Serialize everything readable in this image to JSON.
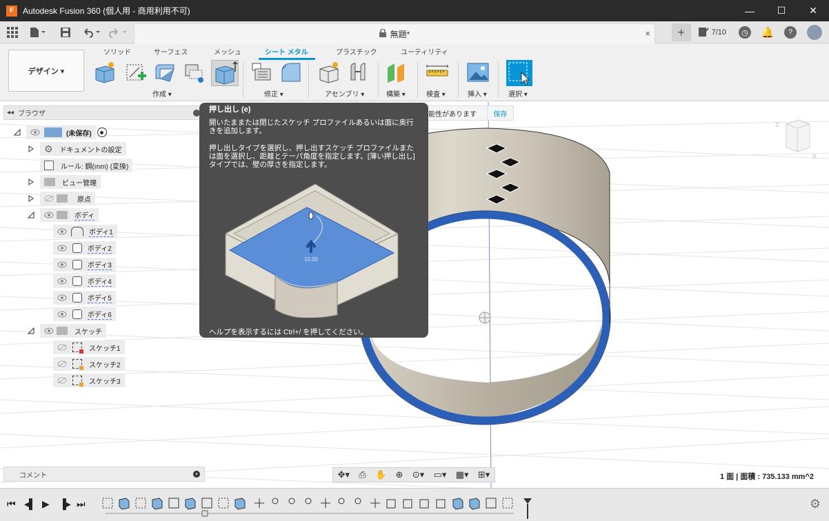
{
  "window": {
    "title": "Autodesk Fusion 360 (個人用 - 商用利用不可)",
    "app_icon": "F",
    "minimize": "—",
    "maximize": "☐",
    "close": "✕"
  },
  "document_tab": {
    "title": "無題*",
    "close": "×"
  },
  "appbar": {
    "jobs_count": "7/10",
    "new_tab": "+"
  },
  "workspace": {
    "label": "デザイン ▾"
  },
  "ribbon_tabs": [
    "ソリッド",
    "サーフェス",
    "メッシュ",
    "シート メタル",
    "プラスチック",
    "ユーティリティ"
  ],
  "ribbon_groups": {
    "create": "作成 ▾",
    "modify": "修正 ▾",
    "assemble": "アセンブリ ▾",
    "construct": "構築 ▾",
    "inspect": "検査 ▾",
    "insert": "挿入 ▾",
    "select": "選択 ▾"
  },
  "browser": {
    "title": "ブラウザ",
    "root": "(未保存)",
    "items": {
      "doc_settings": "ドキュメントの設定",
      "rule": "ルール: 鋼(mm) (変換)",
      "views": "ビュー管理",
      "origin": "原点",
      "bodies": "ボディ",
      "body1": "ボディ1",
      "body2": "ボディ2",
      "body3": "ボディ3",
      "body4": "ボディ4",
      "body5": "ボディ5",
      "body6": "ボディ6",
      "sketches": "スケッチ",
      "sketch1": "スケッチ1",
      "sketch2": "スケッチ2",
      "sketch3": "スケッチ3"
    }
  },
  "save_banner": {
    "text": "能性があります",
    "save": "保存"
  },
  "tooltip": {
    "title": "押し出し (e)",
    "p1": "開いたままたは閉じたスケッチ プロファイルあるいは面に奥行きを追加します。",
    "p2": "押し出しタイプを選択し、押し出すスケッチ プロファイルまたは面を選択し、距離とテーパ角度を指定します。[薄い押し出し]タイプでは、壁の厚さを指定します。",
    "dim_value": "10.00",
    "footer": "ヘルプを表示するには Ctrl+/ を押してください。"
  },
  "comment": {
    "label": "コメント"
  },
  "status": {
    "text": "1 面 | 面積 : 735.133 mm^2"
  },
  "colors": {
    "accent": "#0696d7",
    "ring": "#2b5fb8",
    "wall": "#c8c1b3",
    "titlebar": "#2b2b2b",
    "tooltip": "#4d4d4d"
  }
}
